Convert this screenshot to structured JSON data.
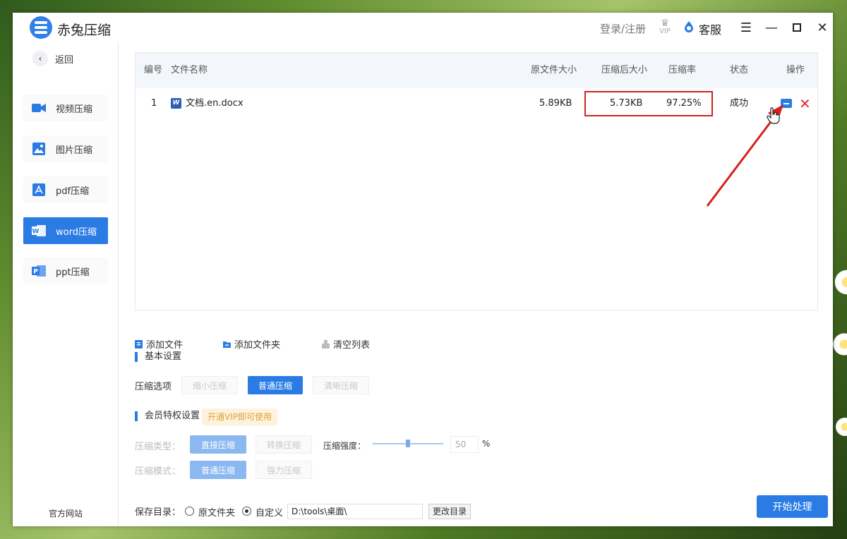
{
  "app": {
    "title": "赤兔压缩",
    "login": "登录/注册",
    "vip": "VIP",
    "support": "客服"
  },
  "sidebar": {
    "back": "返回",
    "items": [
      {
        "label": "视频压缩",
        "icon": "video-icon",
        "active": false
      },
      {
        "label": "图片压缩",
        "icon": "image-icon",
        "active": false
      },
      {
        "label": "pdf压缩",
        "icon": "pdf-icon",
        "active": false
      },
      {
        "label": "word压缩",
        "icon": "word-icon",
        "active": true
      },
      {
        "label": "ppt压缩",
        "icon": "ppt-icon",
        "active": false
      }
    ],
    "official": "官方网站"
  },
  "table": {
    "headers": [
      "编号",
      "文件名称",
      "原文件大小",
      "压缩后大小",
      "压缩率",
      "状态",
      "操作"
    ],
    "rows": [
      {
        "no": "1",
        "name": "文档.en.docx",
        "original": "5.89KB",
        "compressed": "5.73KB",
        "ratio": "97.25%",
        "status": "成功"
      }
    ]
  },
  "toolbar": {
    "add_file": "添加文件",
    "add_folder": "添加文件夹",
    "clear": "清空列表"
  },
  "basic": {
    "title": "基本设置",
    "option_label": "压缩选项",
    "options": [
      "缩小压缩",
      "普通压缩",
      "清晰压缩"
    ],
    "selected": "普通压缩"
  },
  "vip_settings": {
    "title": "会员特权设置",
    "badge": "开通VIP即可使用",
    "type_label": "压缩类型：",
    "types": [
      "直接压缩",
      "转换压缩"
    ],
    "strength_label": "压缩强度：",
    "strength": "50",
    "strength_unit": "%",
    "mode_label": "压缩模式：",
    "modes": [
      "普通压缩",
      "强力压缩"
    ]
  },
  "save": {
    "label": "保存目录：",
    "opt_original": "原文件夹",
    "opt_custom": "自定义",
    "path": "D:\\tools\\桌面\\",
    "change": "更改目录"
  },
  "start": "开始处理",
  "colors": {
    "accent": "#2a7be4",
    "highlight": "#d52020"
  }
}
